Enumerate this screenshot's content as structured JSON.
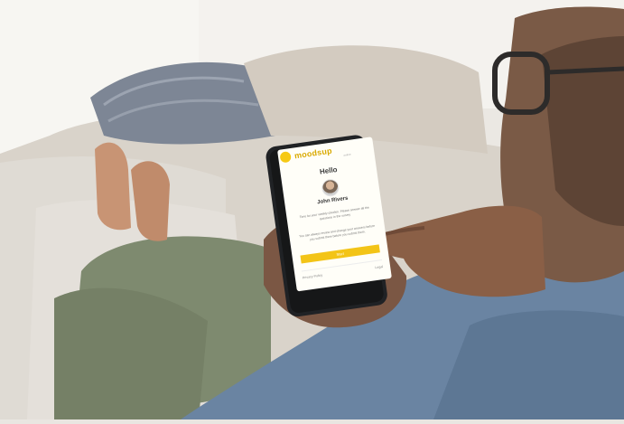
{
  "app": {
    "brand": "moodsup",
    "brand_sub": "online",
    "greeting": "Hello",
    "user_name": "John Rivers",
    "message_1": "Time for your weekly checkin. Please answer all the questions in the survey",
    "message_2": "You can always review and change your answers before you submit them before you submit them.",
    "start_button": "Start",
    "privacy_link": "Privacy Policy",
    "legal_link": "Legal"
  },
  "colors": {
    "accent": "#f3c417",
    "brand": "#d9a900"
  },
  "icons": {
    "logo": "sun-logo-icon",
    "avatar": "user-avatar"
  }
}
